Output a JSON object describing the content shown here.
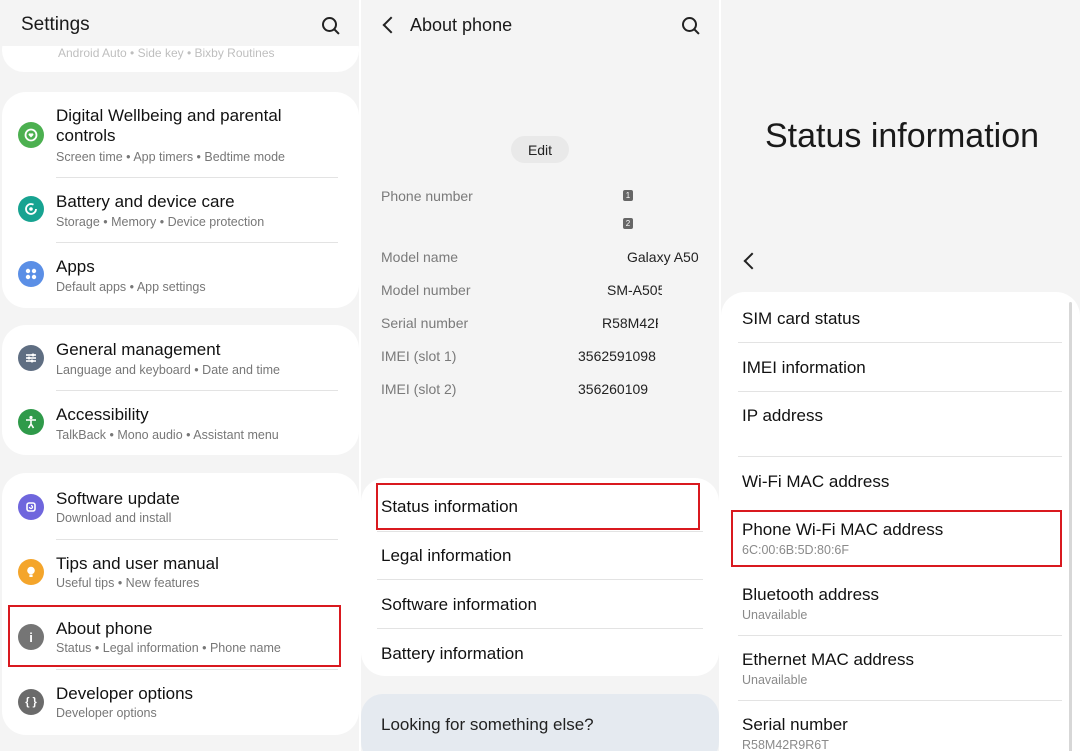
{
  "settings": {
    "title": "Settings",
    "peek_text": "Android Auto  •  Side key  •  Bixby Routines",
    "items": [
      {
        "title": "Digital Wellbeing and parental controls",
        "sub": "Screen time  •  App timers  •  Bedtime mode",
        "icon": "wellbeing-icon",
        "color": "#4cb050"
      },
      {
        "title": "Battery and device care",
        "sub": "Storage  •  Memory  •  Device protection",
        "icon": "battery-care-icon",
        "color": "#17a391"
      },
      {
        "title": "Apps",
        "sub": "Default apps  •  App settings",
        "icon": "apps-icon",
        "color": "#5b8fe6"
      },
      {
        "title": "General management",
        "sub": "Language and keyboard  •  Date and time",
        "icon": "general-management-icon",
        "color": "#5f6e82"
      },
      {
        "title": "Accessibility",
        "sub": "TalkBack  •  Mono audio  •  Assistant menu",
        "icon": "accessibility-icon",
        "color": "#2f9a4a"
      },
      {
        "title": "Software update",
        "sub": "Download and install",
        "icon": "software-update-icon",
        "color": "#6f66dd"
      },
      {
        "title": "Tips and user manual",
        "sub": "Useful tips  •  New features",
        "icon": "tips-icon",
        "color": "#f4a52b"
      },
      {
        "title": "About phone",
        "sub": "Status  •  Legal information  •  Phone name",
        "icon": "info-icon",
        "color": "#757575"
      },
      {
        "title": "Developer options",
        "sub": "Developer options",
        "icon": "developer-icon",
        "color": "#6b6b6b"
      }
    ]
  },
  "about": {
    "title": "About phone",
    "edit_label": "Edit",
    "sim_badges": [
      "1",
      "2"
    ],
    "rows": [
      {
        "label": "Phone number",
        "value": ""
      },
      {
        "label": "Model name",
        "value": "Galaxy A50"
      },
      {
        "label": "Model number",
        "value": "SM-A505"
      },
      {
        "label": "Serial number",
        "value": "R58M42R"
      },
      {
        "label": "IMEI (slot 1)",
        "value": "3562591098"
      },
      {
        "label": "IMEI (slot 2)",
        "value": "356260109"
      }
    ],
    "menu": [
      "Status information",
      "Legal information",
      "Software information",
      "Battery information"
    ],
    "looking_for": "Looking for something else?"
  },
  "status": {
    "title": "Status information",
    "items": [
      {
        "title": "SIM card status",
        "sub": ""
      },
      {
        "title": "IMEI information",
        "sub": ""
      },
      {
        "title": "IP address",
        "sub": ""
      },
      {
        "title": "Wi-Fi MAC address",
        "sub": ""
      },
      {
        "title": "Phone Wi-Fi MAC address",
        "sub": "6C:00:6B:5D:80:6F"
      },
      {
        "title": "Bluetooth address",
        "sub": "Unavailable"
      },
      {
        "title": "Ethernet MAC address",
        "sub": "Unavailable"
      },
      {
        "title": "Serial number",
        "sub": "R58M42R9R6T"
      }
    ]
  },
  "colors": {
    "highlight": "#d9191f",
    "panel_bg": "#f4f4f4",
    "card_bg": "#ffffff"
  }
}
